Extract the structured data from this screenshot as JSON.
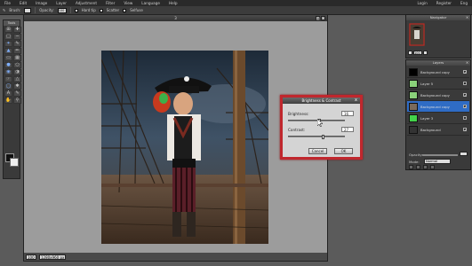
{
  "menu": {
    "items": [
      "File",
      "Edit",
      "Image",
      "Layer",
      "Adjustment",
      "Filter",
      "View",
      "Language",
      "Help"
    ],
    "right": [
      "Login",
      "Register",
      "Eng"
    ]
  },
  "options_bar": {
    "brush_label": "Brush:",
    "opacity_label": "Opacity:",
    "opacity_value": "100",
    "hard_tip_label": "Hard tip",
    "scatter_label": "Scatter",
    "selfuse_label": "Selfuse"
  },
  "tools": {
    "title": "Tools"
  },
  "document": {
    "title": "3",
    "zoom": "100",
    "dimensions": "1280x960 px"
  },
  "dialog": {
    "title": "Brightness & Contrast",
    "close": "x",
    "brightness_label": "Brightness:",
    "brightness_value": "16",
    "brightness_level": 0.55,
    "contrast_label": "Contrast:",
    "contrast_value": "27",
    "contrast_level": 0.62,
    "cancel_label": "Cancel",
    "ok_label": "OK",
    "border_color": "#c0272d"
  },
  "navigator": {
    "title": "Navigator",
    "zoom_value": "100"
  },
  "layers": {
    "title": "Layers",
    "items": [
      {
        "name": "Background copy",
        "color": "#000000"
      },
      {
        "name": "Layer 5",
        "color": "#8ad17a"
      },
      {
        "name": "Background copy",
        "color": "#8ad17a"
      },
      {
        "name": "Background copy",
        "color": "#2f6cc5"
      },
      {
        "name": "Layer 3",
        "color": "#43d34a"
      },
      {
        "name": "Background",
        "color": "#333333"
      }
    ],
    "selected_index": 3,
    "opacity_label": "Opacity:",
    "mode_label": "Mode:",
    "mode_value": "Normal"
  }
}
